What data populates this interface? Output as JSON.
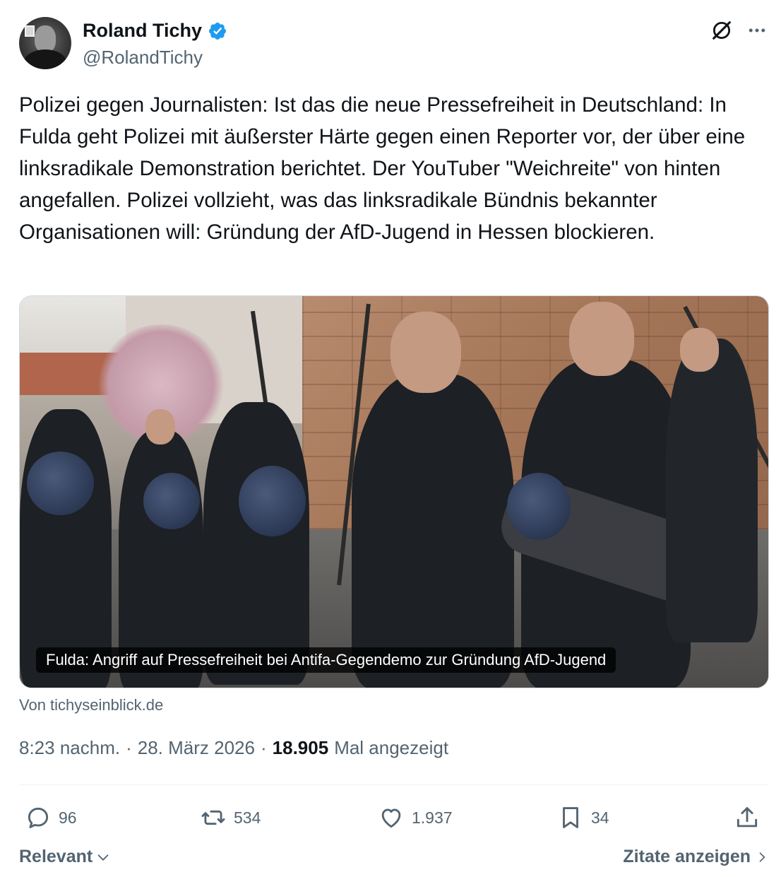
{
  "author": {
    "name": "Roland Tichy",
    "handle": "@RolandTichy"
  },
  "tweet": {
    "text": "Polizei gegen Journalisten: Ist das die neue Pressefreiheit in Deutschland: In Fulda geht Polizei mit äußerster Härte gegen einen Reporter vor, der über eine linksradikale Demonstration berichtet. Der YouTuber \"Weichreite\" von hinten angefallen. Polizei vollzieht, was das linksradikale Bündnis bekannter Organisationen will: Gründung der AfD-Jugend in Hessen blockieren."
  },
  "media": {
    "caption": "Fulda: Angriff auf Pressefreiheit bei Antifa-Gegendemo zur Gründung AfD-Jugend",
    "source": "Von tichyseinblick.de"
  },
  "meta": {
    "time": "8:23 nachm.",
    "separator": "·",
    "date": "28. März 2026",
    "views_count": "18.905",
    "views_label": "Mal angezeigt"
  },
  "actions": {
    "replies": "96",
    "reposts": "534",
    "likes": "1.937",
    "bookmarks": "34"
  },
  "footer": {
    "sort_label": "Relevant",
    "quotes_label": "Zitate anzeigen"
  },
  "colors": {
    "text_primary": "#0f1419",
    "text_secondary": "#536471",
    "verified_blue": "#1d9bf0",
    "border": "#cfd9de"
  },
  "icons": [
    "verified-badge-icon",
    "grok-icon",
    "more-icon",
    "reply-icon",
    "repost-icon",
    "like-icon",
    "bookmark-icon",
    "share-icon",
    "chevron-down-icon",
    "chevron-right-icon"
  ]
}
